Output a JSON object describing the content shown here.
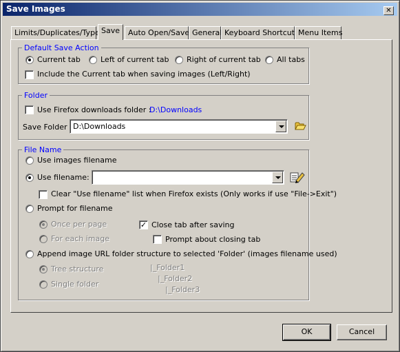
{
  "window": {
    "title": "Save Images",
    "close_glyph": "✕"
  },
  "tabs": [
    {
      "label": "Limits/Duplicates/Types",
      "active": false
    },
    {
      "label": "Save",
      "active": true
    },
    {
      "label": "Auto Open/Save",
      "active": false
    },
    {
      "label": "General",
      "active": false
    },
    {
      "label": "Keyboard Shortcuts",
      "active": false
    },
    {
      "label": "Menu Items",
      "active": false
    }
  ],
  "default_save_action": {
    "legend": "Default Save Action",
    "options": [
      "Current tab",
      "Left of current tab",
      "Right of current tab",
      "All tabs"
    ],
    "selected": "Current tab",
    "include_current_label": "Include the Current tab when saving images (Left/Right)",
    "include_current_checked": false
  },
  "folder": {
    "legend": "Folder",
    "use_downloads_label": "Use Firefox downloads folder :",
    "use_downloads_checked": false,
    "downloads_path": "D:\\Downloads",
    "save_folder_label": "Save Folder",
    "save_folder_value": "D:\\Downloads",
    "browse_icon": "folder-open-icon"
  },
  "file_name": {
    "legend": "File Name",
    "use_images_filename_label": "Use images filename",
    "use_filename_label": "Use filename:",
    "use_filename_value": "",
    "selected": "Use filename:",
    "edit_icon": "edit-list-icon",
    "clear_list_label": "Clear \"Use filename\" list when Firefox exists (Only works if use \"File->Exit\")",
    "clear_list_checked": false,
    "prompt_label": "Prompt for filename",
    "once_per_page_label": "Once per page",
    "for_each_image_label": "For each image",
    "prompt_sub_selected": "Once per page",
    "close_tab_label": "Close tab after saving",
    "close_tab_checked": true,
    "prompt_closing_label": "Prompt about closing tab",
    "prompt_closing_checked": false,
    "append_url_label": "Append image URL folder structure to selected 'Folder' (images filename used)",
    "tree_structure_label": "Tree structure",
    "single_folder_label": "Single folder",
    "append_sub_selected": "Tree structure",
    "tree_lines": [
      "|_Folder1",
      "|_Folder2",
      "|_Folder3"
    ]
  },
  "buttons": {
    "ok": "OK",
    "cancel": "Cancel"
  },
  "colors": {
    "title_start": "#0a246a",
    "title_end": "#a6caf0",
    "face": "#d4d0c8",
    "legend": "#0000ff"
  }
}
